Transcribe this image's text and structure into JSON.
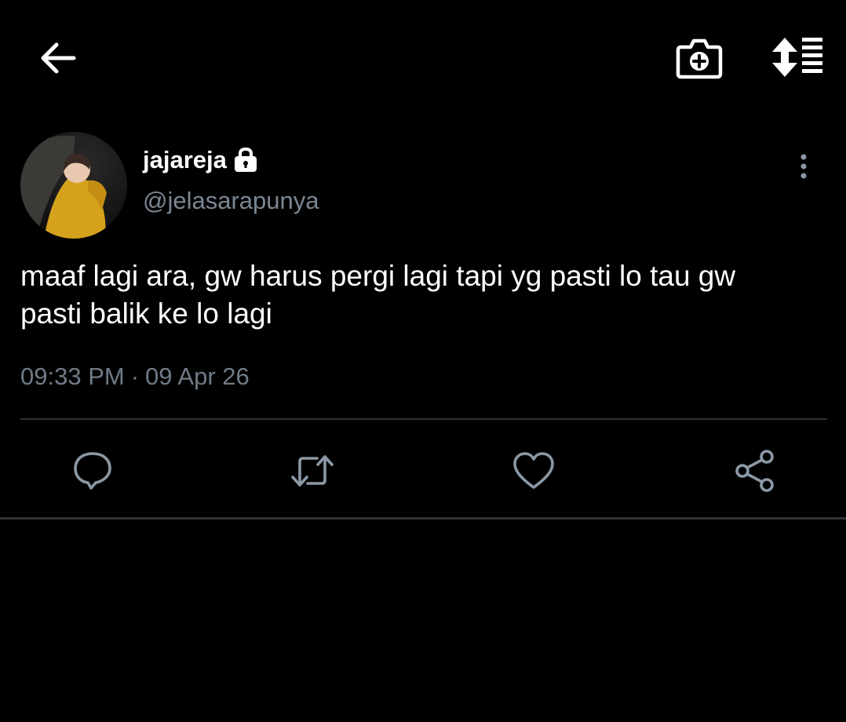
{
  "topbar": {
    "back_icon": "arrow-left-icon",
    "camera_icon": "camera-add-icon",
    "sort_icon": "sort-list-icon"
  },
  "tweet": {
    "display_name": "jajareja",
    "handle": "@jelasarapunya",
    "protected_icon": "lock-icon",
    "more_icon": "more-vertical-icon",
    "text": "maaf lagi ara, gw harus pergi lagi tapi yg pasti lo tau gw\npasti balik ke lo lagi",
    "time": "09:33 PM",
    "separator": "·",
    "date": "09 Apr 26"
  },
  "actions": {
    "reply_icon": "reply-icon",
    "retweet_icon": "retweet-icon",
    "like_icon": "heart-icon",
    "share_icon": "share-icon"
  },
  "colors": {
    "background": "#000000",
    "primary_text": "#ffffff",
    "secondary_text": "#7b8793",
    "icon_gray": "#8b98a5",
    "divider": "#2f3337"
  }
}
